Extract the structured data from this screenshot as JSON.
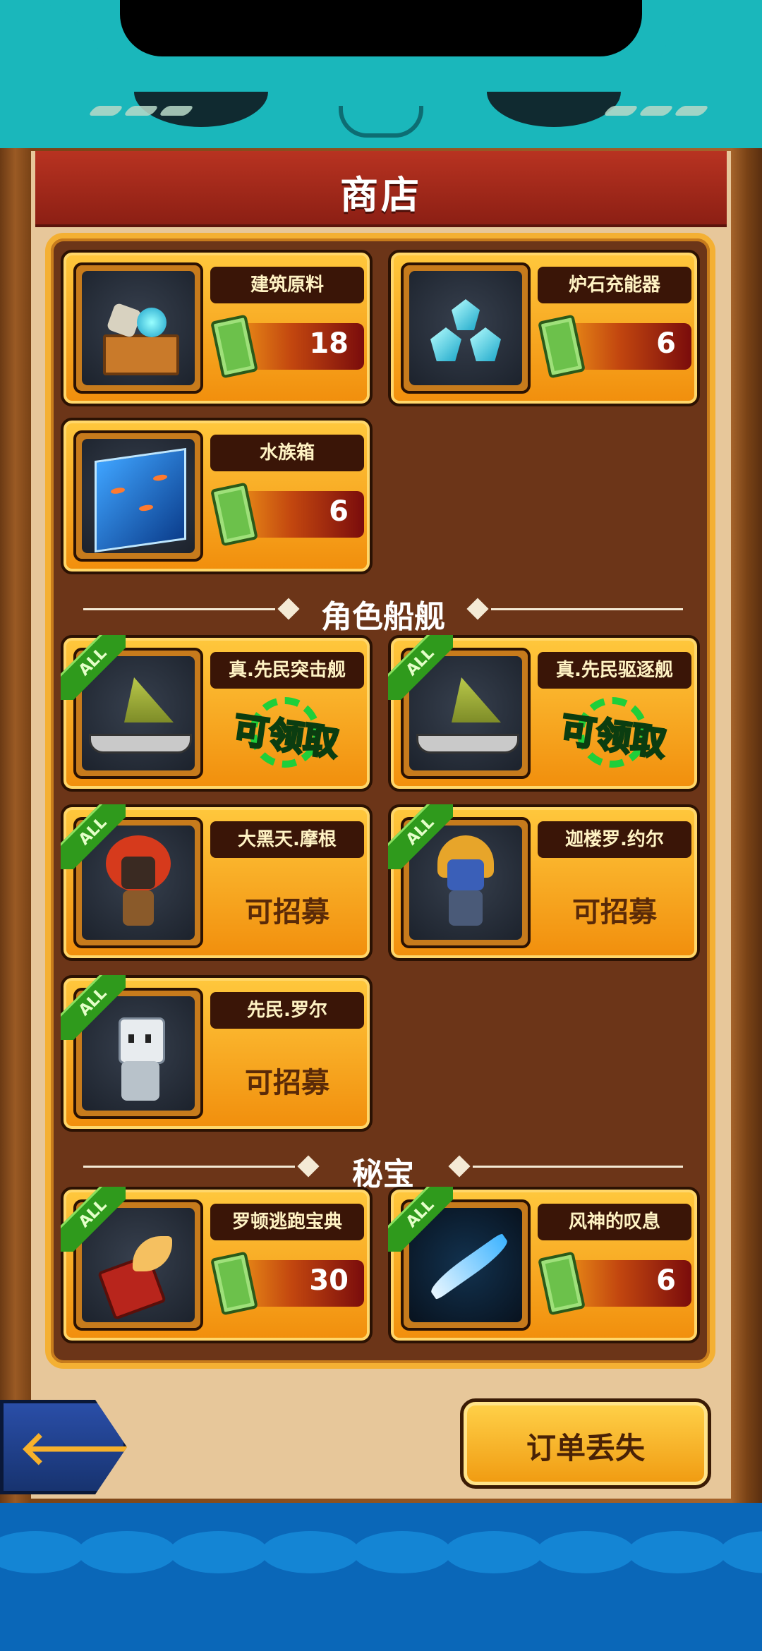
{
  "header": {
    "title": "商店"
  },
  "shop_items": [
    {
      "name": "建筑原料",
      "price": "18",
      "icon": "crate-ore-icon"
    },
    {
      "name": "炉石充能器",
      "price": "6",
      "icon": "crystal-icon"
    },
    {
      "name": "水族箱",
      "price": "6",
      "icon": "aquarium-icon"
    }
  ],
  "ships_section": {
    "title": "角色船舰",
    "items": [
      {
        "tag": "ALL",
        "name": "真.先民突击舰",
        "status": "可领取",
        "icon": "sailship-icon"
      },
      {
        "tag": "ALL",
        "name": "真.先民驱逐舰",
        "status": "可领取",
        "icon": "sailship-icon"
      },
      {
        "tag": "ALL",
        "name": "大黑天.摩根",
        "status": "可招募",
        "icon": "red-hair-hero-icon"
      },
      {
        "tag": "ALL",
        "name": "迦楼罗.约尔",
        "status": "可招募",
        "icon": "garuda-hero-icon"
      },
      {
        "tag": "ALL",
        "name": "先民.罗尔",
        "status": "可招募",
        "icon": "robot-hero-icon"
      }
    ]
  },
  "treasure_section": {
    "title": "秘宝",
    "items": [
      {
        "tag": "ALL",
        "name": "罗顿逃跑宝典",
        "price": "30",
        "icon": "winged-book-icon"
      },
      {
        "tag": "ALL",
        "name": "风神的叹息",
        "price": "6",
        "icon": "blue-feather-icon"
      }
    ]
  },
  "footer": {
    "back_label": "🡐",
    "order_lost_label": "订单丢失"
  },
  "colors": {
    "card": "#f9ae22",
    "panel": "#6c3518",
    "title_bar": "#a8281b",
    "claim_green": "#33e04b"
  }
}
